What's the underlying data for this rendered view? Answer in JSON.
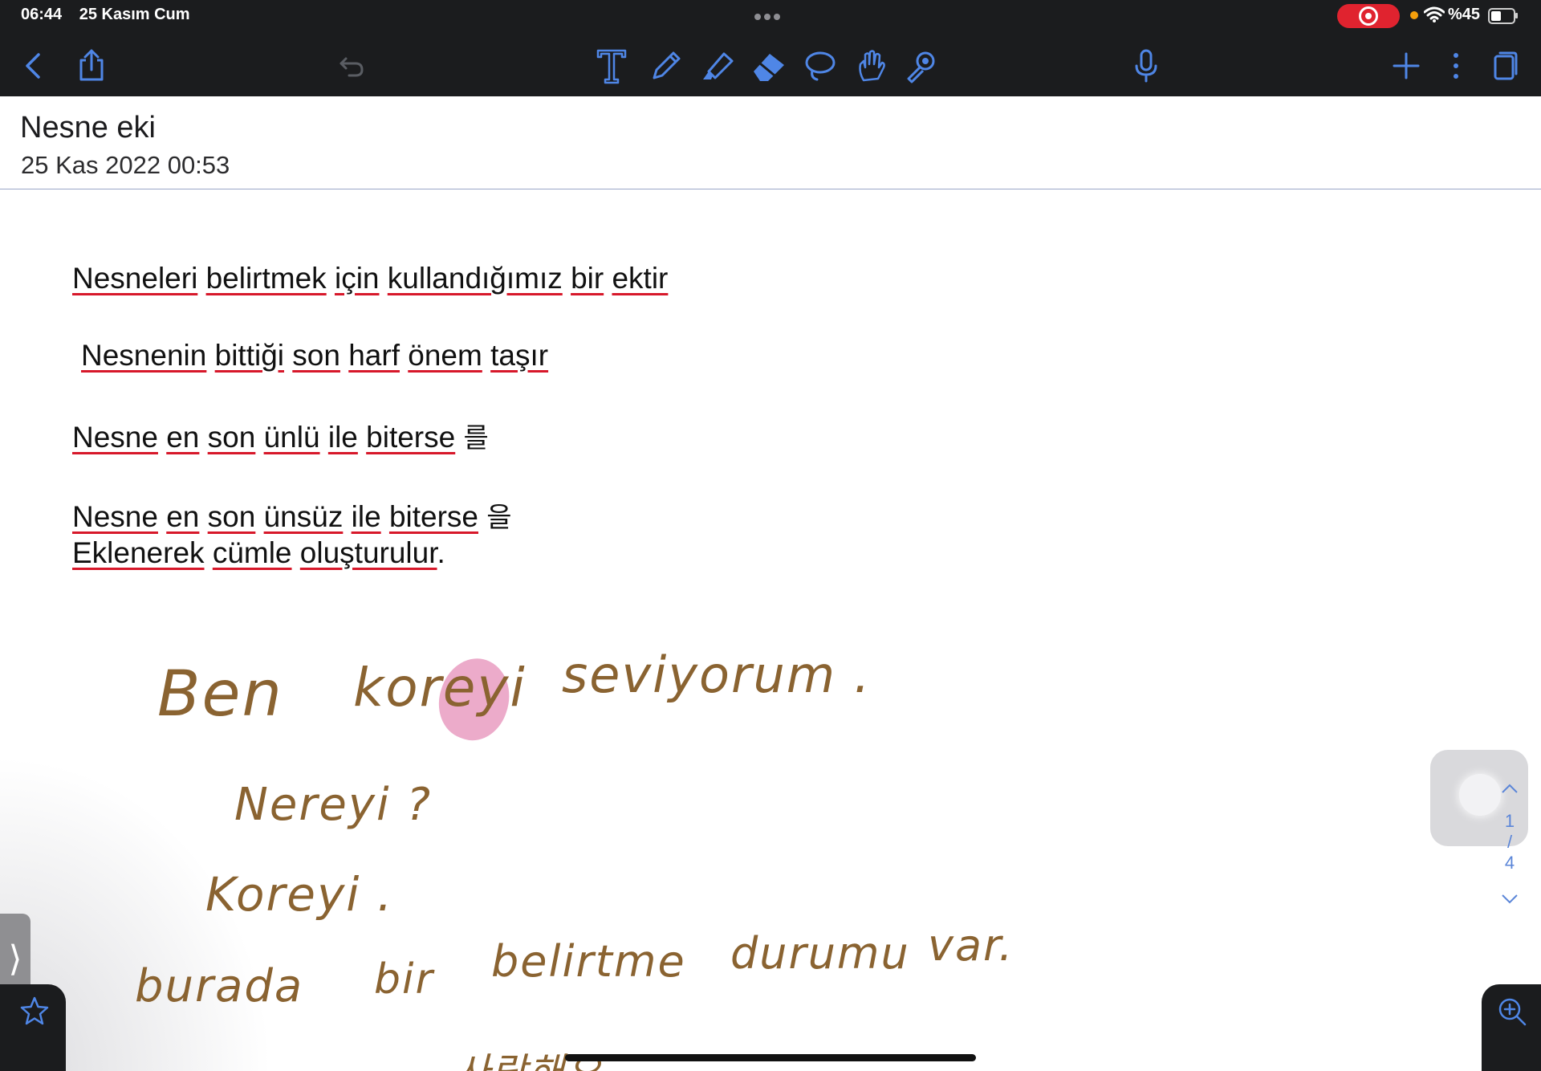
{
  "status_bar": {
    "time": "06:44",
    "date": "25 Kasım Cum",
    "battery": "%45"
  },
  "toolbar": {
    "icons": [
      "chevron-left-icon",
      "share-icon",
      "undo-icon",
      "text-tool-icon",
      "pen-icon",
      "highlighter-icon",
      "eraser-icon",
      "lasso-icon",
      "hand-icon",
      "laser-pointer-icon",
      "microphone-icon",
      "plus-icon",
      "more-icon",
      "pages-icon"
    ],
    "accent": "#4f86e6"
  },
  "document": {
    "title": "Nesne eki",
    "date": "25 Kas 2022 00:53"
  },
  "typed_lines": {
    "line1": [
      "Nesneleri",
      "belirtmek",
      "için",
      "kullandığımız",
      "bir",
      "ektir"
    ],
    "line2": [
      "Nesnenin",
      "bittiği",
      "son",
      "harf",
      "önem",
      "taşır"
    ],
    "line3": [
      "Nesne",
      "en",
      "son",
      "ünlü",
      "ile",
      "biterse"
    ],
    "line3_particle": "를",
    "line4": [
      "Nesne",
      "en",
      "son",
      "ünsüz",
      "ile",
      "biterse"
    ],
    "line4_particle": "을",
    "line5": [
      "Eklenerek",
      "cümle",
      "oluşturulur"
    ],
    "line5_end": "."
  },
  "handwriting": {
    "line1_a": "Ben",
    "line1_b": "koreyi",
    "line1_c": "seviyorum .",
    "line2": "Nereyi ?",
    "line3": "Koreyi .",
    "line4_a": "burada",
    "line4_b": "bir",
    "line4_c": "belirtme",
    "line4_d": "durumu",
    "line4_e": "var.",
    "line5": "사랑해요",
    "ink_color": "#8a6331",
    "highlight_color": "#e58fb8"
  },
  "page_indicator": {
    "current": "1",
    "separator": "/",
    "total": "4"
  }
}
